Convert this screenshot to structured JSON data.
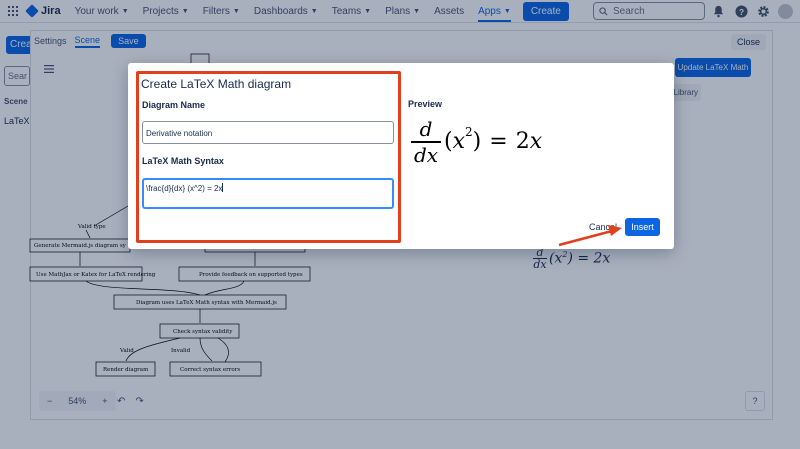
{
  "topnav": {
    "app_name": "Jira",
    "items": [
      {
        "label": "Your work",
        "active": false
      },
      {
        "label": "Projects",
        "active": false
      },
      {
        "label": "Filters",
        "active": false
      },
      {
        "label": "Dashboards",
        "active": false
      },
      {
        "label": "Teams",
        "active": false
      },
      {
        "label": "Plans",
        "active": false
      },
      {
        "label": "Assets",
        "active": false
      },
      {
        "label": "Apps",
        "active": true
      }
    ],
    "create_label": "Create",
    "search_placeholder": "Search",
    "icons": [
      "apps-grid-icon",
      "notifications-icon",
      "help-icon",
      "settings-icon",
      "avatar"
    ]
  },
  "background": {
    "create_label": "Crea",
    "search_placeholder": "Sear",
    "scene_header": "Scene N",
    "scene_item": "LaTeX I",
    "tabs": [
      "Settings",
      "Scene"
    ],
    "active_tab": "Scene",
    "save_label": "Save",
    "close_label": "Close",
    "update_label": "Update LaTeX Math",
    "library_label": "Library",
    "zoom_level": "54%",
    "flowchart": {
      "nodes": [
        "Generate Mermaid.js diagram sy",
        "Use MathJax or Katex for LaTeX rendering",
        "Provide feedback on supported types",
        "Diagram uses LaTeX Math syntax with Mermaid.js",
        "Check syntax validity",
        "Render diagram",
        "Correct syntax errors"
      ],
      "edge_labels": [
        "Valid type",
        "Valid",
        "Invalid"
      ]
    }
  },
  "modal": {
    "title": "Create LaTeX Math diagram",
    "name_label": "Diagram Name",
    "name_value": "Derivative notation",
    "syntax_label": "LaTeX Math Syntax",
    "syntax_value": "\\frac{d}{dx} (x^2) = 2x",
    "preview_label": "Preview",
    "cancel_label": "Cancel",
    "insert_label": "Insert"
  },
  "colors": {
    "accent": "#0c66e4",
    "highlight": "#e2401c"
  }
}
